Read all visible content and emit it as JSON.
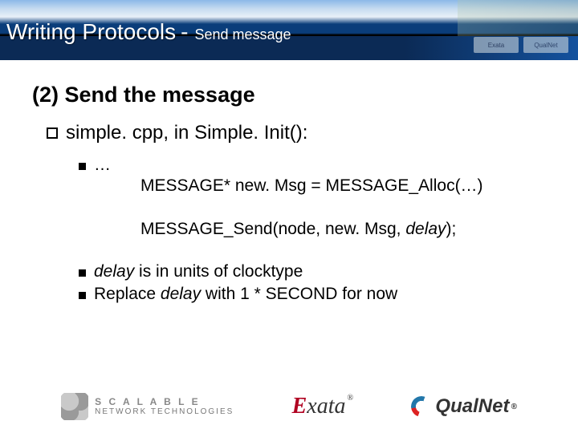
{
  "header": {
    "title_main": "Writing Protocols",
    "title_dash_suffix": "-",
    "title_sub": "Send message"
  },
  "content": {
    "section_heading": "(2) Send the message",
    "bullet_l1": "simple. cpp, in Simple. Init():",
    "code_block": {
      "ellipsis": "…",
      "line1": "MESSAGE* new. Msg = MESSAGE_Alloc(…)",
      "line2_pre": "MESSAGE_Send(node, new. Msg, ",
      "line2_ital": "delay",
      "line2_post": ");"
    },
    "notes": {
      "n1_pre": "",
      "n1_ital": "delay",
      "n1_post": " is in units of clocktype",
      "n2_pre": "Replace ",
      "n2_ital": "delay",
      "n2_post": " with 1 * SECOND for now"
    }
  },
  "logos": {
    "snt_top": "S C A L A B L E",
    "snt_bottom": "NETWORK TECHNOLOGIES",
    "exata_e": "E",
    "exata_rest": "xata",
    "exata_reg": "®",
    "qualnet": "QualNet",
    "qualnet_reg": "®",
    "mini1": "Exata",
    "mini2": "QualNet"
  }
}
